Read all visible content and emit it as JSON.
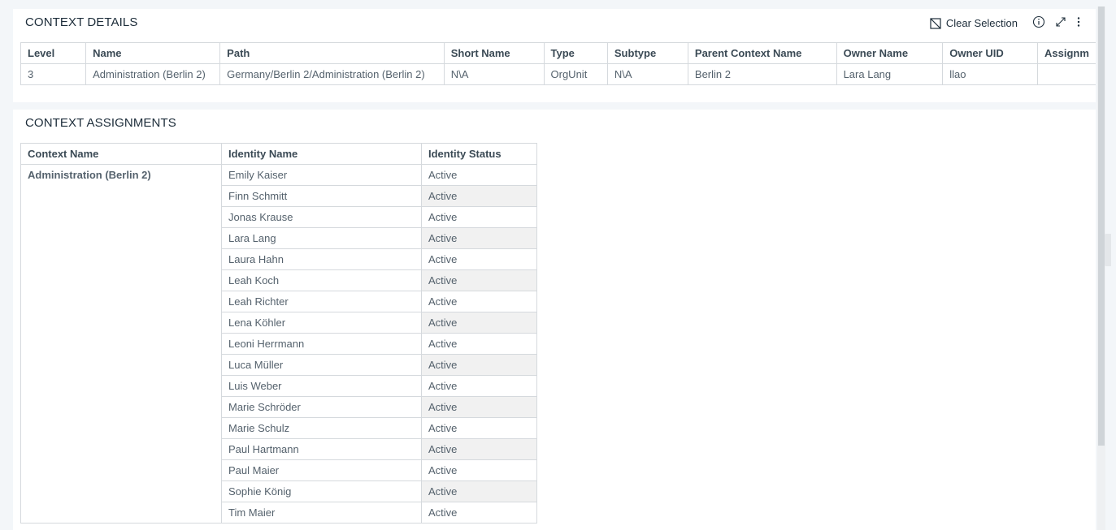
{
  "context_details": {
    "title": "CONTEXT DETAILS",
    "toolbar": {
      "clear_selection_label": "Clear Selection",
      "clear_selection_icon": "clear-selection-icon",
      "info_icon": "info-icon",
      "expand_icon": "expand-icon",
      "menu_icon": "more-vertical-icon"
    },
    "columns": [
      "Level",
      "Name",
      "Path",
      "Short Name",
      "Type",
      "Subtype",
      "Parent Context Name",
      "Owner Name",
      "Owner UID",
      "Assignm"
    ],
    "rows": [
      [
        "3",
        "Administration (Berlin 2)",
        "Germany/Berlin 2/Administration (Berlin 2)",
        "N\\A",
        "OrgUnit",
        "N\\A",
        "Berlin 2",
        "Lara Lang",
        "llao",
        ""
      ]
    ]
  },
  "context_assignments": {
    "title": "CONTEXT ASSIGNMENTS",
    "columns": [
      "Context Name",
      "Identity Name",
      "Identity Status"
    ],
    "context_name": "Administration (Berlin 2)",
    "rows": [
      {
        "identity": "Emily Kaiser",
        "status": "Active"
      },
      {
        "identity": "Finn Schmitt",
        "status": "Active"
      },
      {
        "identity": "Jonas Krause",
        "status": "Active"
      },
      {
        "identity": "Lara Lang",
        "status": "Active"
      },
      {
        "identity": "Laura Hahn",
        "status": "Active"
      },
      {
        "identity": "Leah Koch",
        "status": "Active"
      },
      {
        "identity": "Leah Richter",
        "status": "Active"
      },
      {
        "identity": "Lena Köhler",
        "status": "Active"
      },
      {
        "identity": "Leoni Herrmann",
        "status": "Active"
      },
      {
        "identity": "Luca Müller",
        "status": "Active"
      },
      {
        "identity": "Luis Weber",
        "status": "Active"
      },
      {
        "identity": "Marie Schröder",
        "status": "Active"
      },
      {
        "identity": "Marie Schulz",
        "status": "Active"
      },
      {
        "identity": "Paul Hartmann",
        "status": "Active"
      },
      {
        "identity": "Paul Maier",
        "status": "Active"
      },
      {
        "identity": "Sophie König",
        "status": "Active"
      },
      {
        "identity": "Tim Maier",
        "status": "Active"
      }
    ]
  },
  "colors": {
    "background": "#f3f6f9",
    "panel": "#ffffff",
    "border": "#d5d9dd",
    "alt_row": "#f1f1f1"
  }
}
